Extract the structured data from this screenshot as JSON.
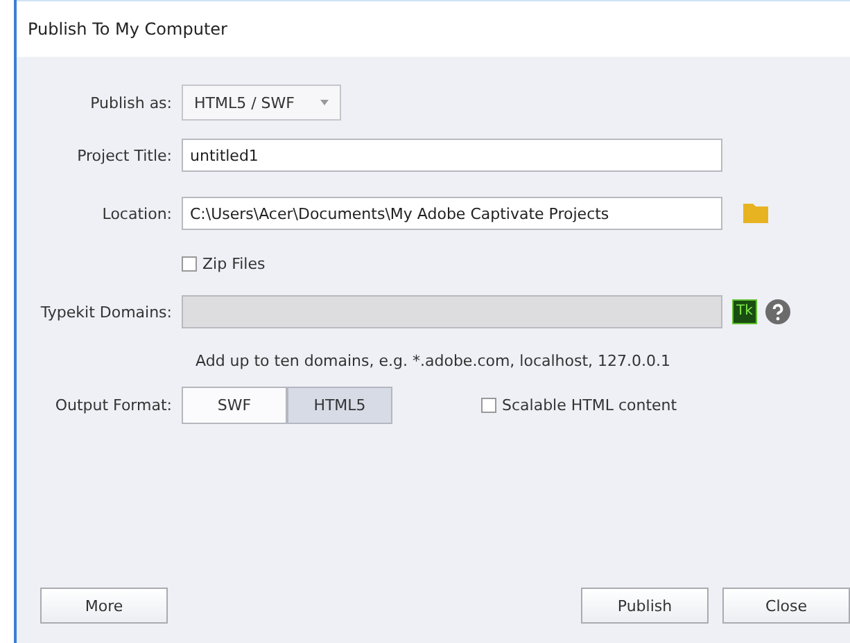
{
  "window": {
    "title": "Publish To My Computer"
  },
  "publish_as": {
    "label": "Publish as:",
    "value": "HTML5 / SWF"
  },
  "project_title": {
    "label": "Project Title:",
    "value": "untitled1"
  },
  "location": {
    "label": "Location:",
    "value": "C:\\Users\\Acer\\Documents\\My Adobe Captivate Projects"
  },
  "zip_files": {
    "label": "Zip Files",
    "checked": false
  },
  "typekit": {
    "label": "Typekit Domains:",
    "disabled": true,
    "badge": "Tk",
    "hint": "Add up to ten domains, e.g. *.adobe.com, localhost, 127.0.0.1"
  },
  "output_format": {
    "label": "Output Format:",
    "options": [
      {
        "label": "SWF",
        "selected": false
      },
      {
        "label": "HTML5",
        "selected": true
      }
    ]
  },
  "scalable": {
    "label": "Scalable HTML content",
    "checked": false
  },
  "buttons": [
    {
      "label": "More",
      "kind": "left"
    },
    {
      "label": "Publish",
      "kind": "right"
    },
    {
      "label": "Close",
      "kind": "right"
    }
  ]
}
